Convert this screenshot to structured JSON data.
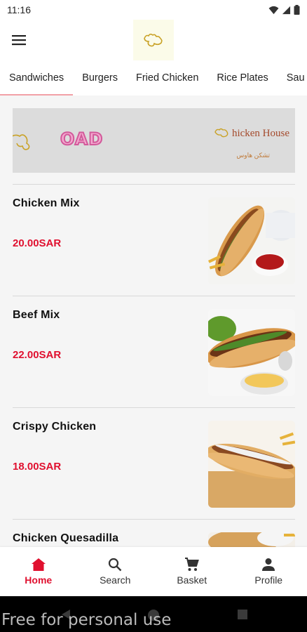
{
  "status_bar": {
    "time": "11:16"
  },
  "app_bar": {
    "menu_icon": "hamburger-menu-icon",
    "logo_icon": "chicken-house-logo-icon"
  },
  "tabs": [
    {
      "label": "Sandwiches"
    },
    {
      "label": "Burgers"
    },
    {
      "label": "Fried Chicken"
    },
    {
      "label": "Rice Plates"
    },
    {
      "label": "Sau"
    }
  ],
  "banner": {
    "left_text": "OAD",
    "brand_name": "hicken House",
    "brand_ar": "تشكن هاوس"
  },
  "items": [
    {
      "name": "Chicken Mix",
      "price": "20.00SAR"
    },
    {
      "name": "Beef Mix",
      "price": "22.00SAR"
    },
    {
      "name": "Crispy Chicken",
      "price": "18.00SAR"
    },
    {
      "name": "Chicken Quesadilla",
      "price": ""
    }
  ],
  "bottom_nav": [
    {
      "label": "Home",
      "icon": "home-icon"
    },
    {
      "label": "Search",
      "icon": "search-icon"
    },
    {
      "label": "Basket",
      "icon": "cart-icon"
    },
    {
      "label": "Profile",
      "icon": "person-icon"
    }
  ],
  "watermark": "Free for personal use",
  "colors": {
    "accent": "#e0102f",
    "tab_indicator": "#f2a0a6",
    "background": "#f5f5f5"
  }
}
